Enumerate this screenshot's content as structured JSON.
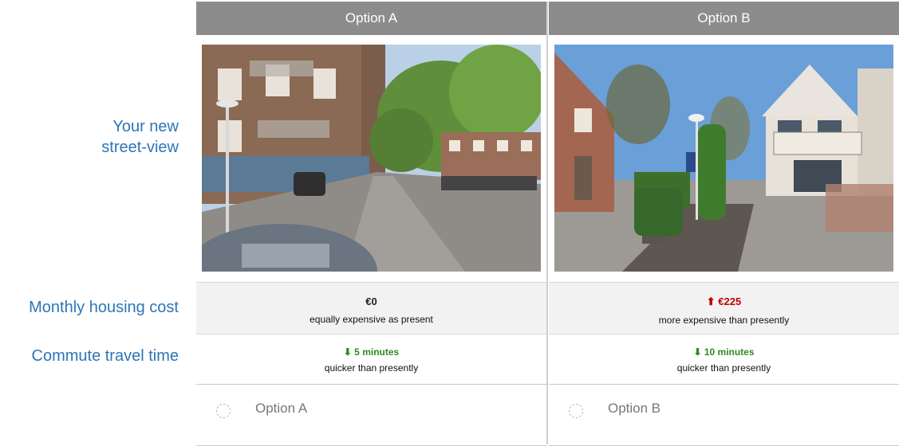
{
  "row_labels": {
    "street_view": "Your new street-view",
    "housing_cost": "Monthly housing cost",
    "commute": "Commute travel time"
  },
  "options": [
    {
      "header": "Option A",
      "photo": "urban-street-apartments-photo",
      "cost_value": "€0",
      "cost_desc": "equally expensive as present",
      "commute_value": "⬇ 5 minutes",
      "commute_desc": "quicker than presently",
      "choice_label": "Option A"
    },
    {
      "header": "Option B",
      "photo": "suburban-houses-photo",
      "cost_value": "⬆ €225",
      "cost_desc": "more expensive than presently",
      "commute_value": "⬇ 10 minutes",
      "commute_desc": "quicker than presently",
      "choice_label": "Option B"
    }
  ],
  "colors": {
    "label_blue": "#2e75b6",
    "header_grey": "#8c8c8c",
    "increase_red": "#c00000",
    "decrease_green": "#2e8b20"
  }
}
